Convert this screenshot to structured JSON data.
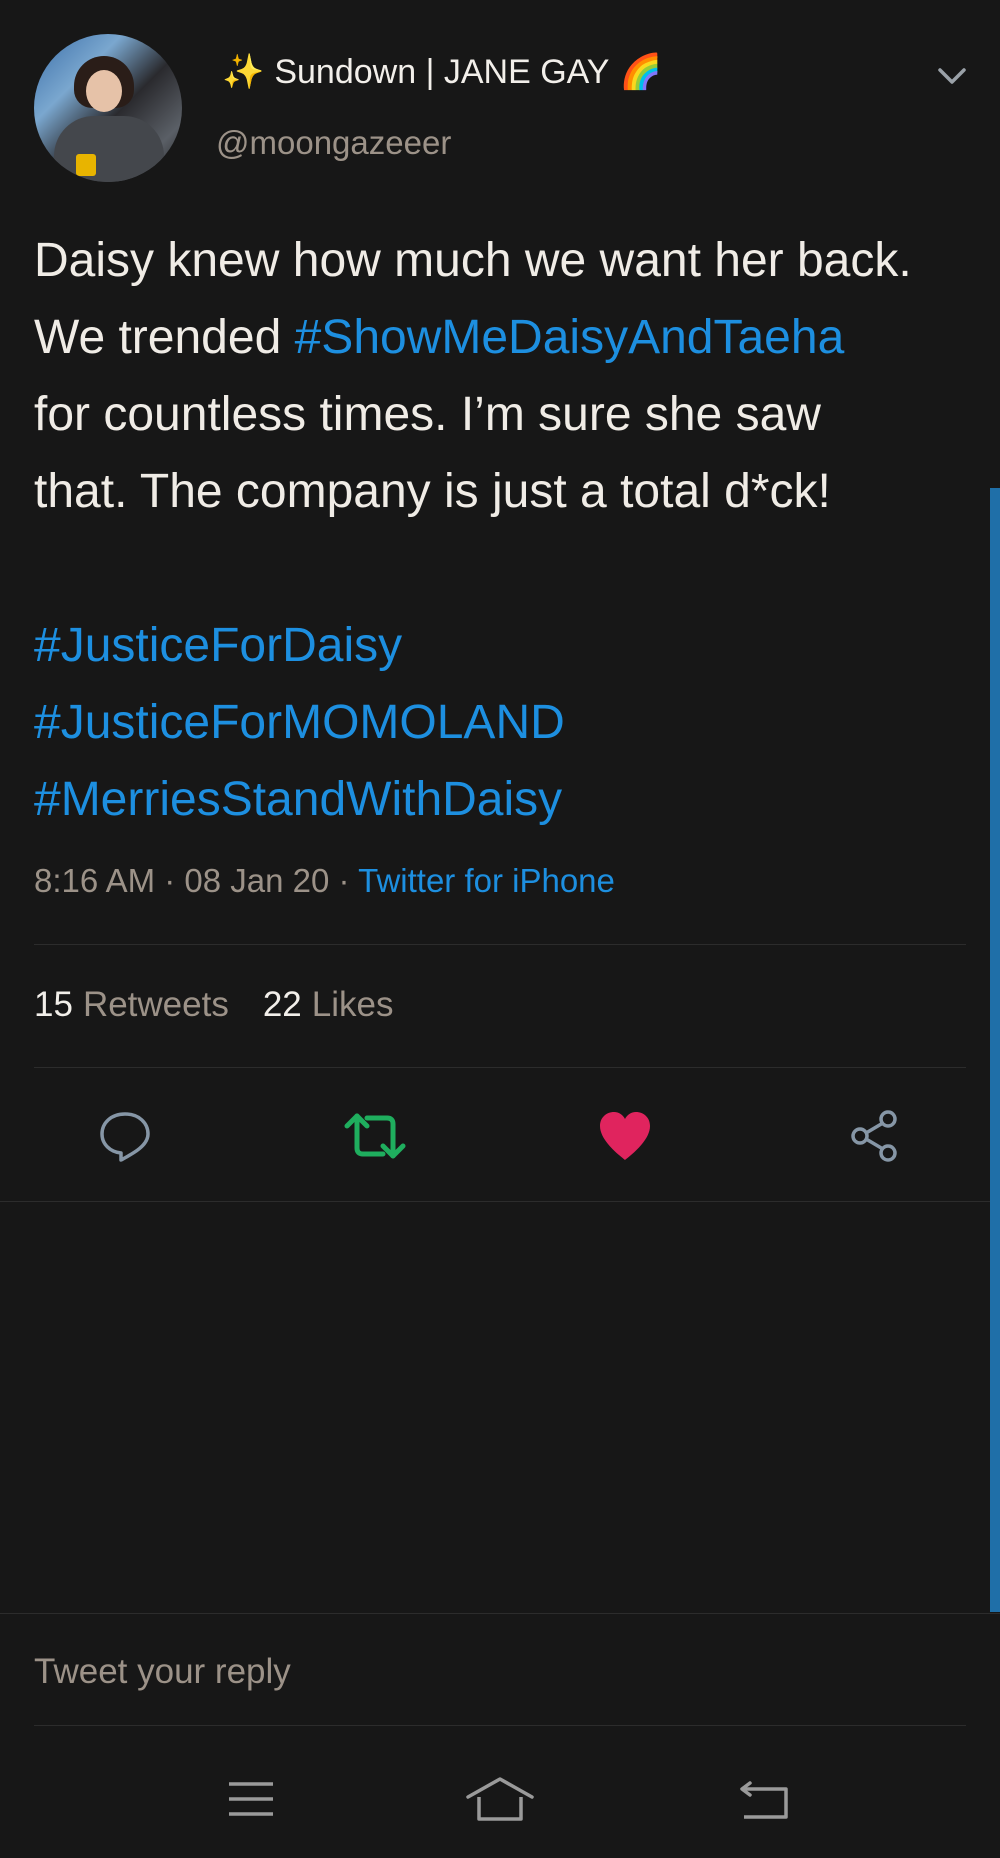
{
  "author": {
    "sparkle_emoji": "✨",
    "name": "Sundown | JANE GAY",
    "rainbow_emoji": "🌈",
    "handle": "@moongazeeer"
  },
  "tweet": {
    "lines": [
      {
        "text": "Daisy knew how much we want her back."
      },
      {
        "pre": "We trended ",
        "tag": "#ShowMeDaisyAndTaeha"
      },
      {
        "text": "for countless times. I’m sure she saw"
      },
      {
        "text": "that. The company is just a total d*ck!"
      }
    ],
    "hashtags": [
      "#JusticeForDaisy",
      "#JusticeForMOMOLAND",
      "#MerriesStandWithDaisy"
    ]
  },
  "meta": {
    "time": "8:16 AM",
    "sep1": " · ",
    "date": "08 Jan 20",
    "sep2": " · ",
    "source": "Twitter for iPhone"
  },
  "stats": {
    "retweets_count": "15",
    "retweets_label": "Retweets",
    "likes_count": "22",
    "likes_label": "Likes"
  },
  "actions": {
    "reply_icon": "reply-icon",
    "retweet_icon": "retweet-icon",
    "like_icon": "heart-icon",
    "share_icon": "share-icon"
  },
  "reply": {
    "placeholder": "Tweet your reply"
  },
  "colors": {
    "background": "#171717",
    "link": "#1d8fe0",
    "retweet_active": "#1fae5e",
    "like_active": "#e0245e",
    "muted": "#9c9288",
    "scrollbar": "#1f6fa8"
  }
}
